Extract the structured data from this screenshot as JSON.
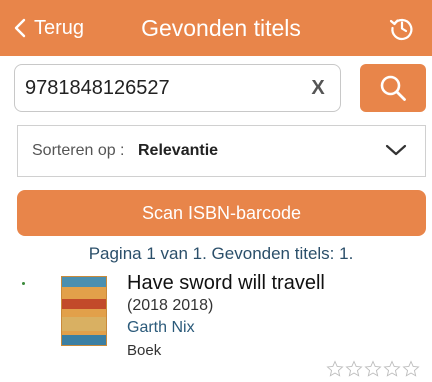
{
  "header": {
    "back_label": "Terug",
    "title": "Gevonden titels",
    "icons": {
      "back": "chevron-left-icon",
      "history": "history-clock-icon"
    }
  },
  "search": {
    "value": "9781848126527",
    "clear_label": "X",
    "icon": "search-icon"
  },
  "sort": {
    "label": "Sorteren op :",
    "value": "Relevantie",
    "icon": "chevron-down-icon"
  },
  "scan_button": {
    "label": "Scan ISBN-barcode"
  },
  "pagination": {
    "text": "Pagina 1 van 1. Gevonden titels: 1."
  },
  "results": [
    {
      "title": "Have sword will travell",
      "year": "(2018 2018)",
      "author": "Garth Nix",
      "type": "Boek",
      "rating": 0,
      "rating_max": 5
    }
  ],
  "colors": {
    "accent": "#e8854a",
    "link": "#2b5a7a",
    "pagination_text": "#2b4f6a"
  }
}
